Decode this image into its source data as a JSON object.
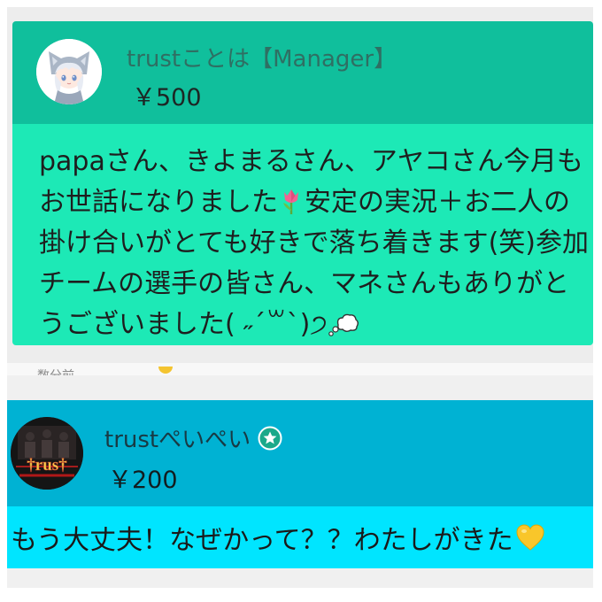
{
  "cards": [
    {
      "username": "trustことは【Manager】",
      "amount": "￥500",
      "message_part1": "papaさん、きよまるさん、アヤコさん今月もお世話になりました",
      "message_part2": "安定の実況＋お二人の掛け合いがとても好きで落ち着きます(笑)参加チームの選手の皆さん、マネさんもありがとうございました( ˶´꒳`)੭",
      "icons": [
        "tulip-icon",
        "thought-bubble-icon"
      ],
      "colors": {
        "header": "#10bf9c",
        "body": "#1de9b6"
      }
    },
    {
      "username": "trustぺいぺい",
      "amount": "￥200",
      "message": "もう大丈夫！なぜかって？？わたしがきた",
      "icons": [
        "verified-star-badge-icon",
        "yellow-heart-icon"
      ],
      "colors": {
        "header": "#00b2d3",
        "body": "#00e5ff",
        "badge": "#1aa98a"
      }
    }
  ],
  "partial_row_text": "数分前 ",
  "accent": {
    "coin": "#f4c430"
  }
}
